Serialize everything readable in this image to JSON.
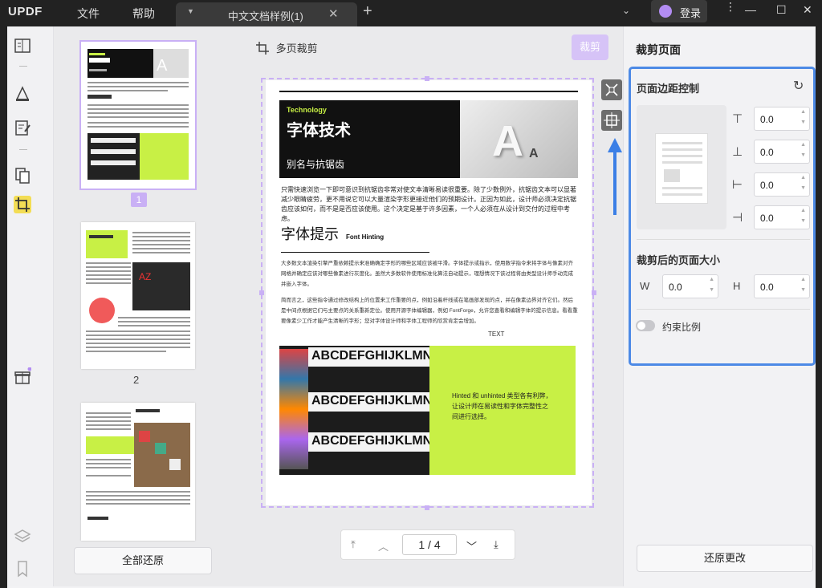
{
  "app": {
    "logo_a": "UPDF",
    "menu_file": "文件",
    "menu_help": "帮助"
  },
  "tab": {
    "title": "中文文档样例(1)"
  },
  "login": {
    "label": "登录"
  },
  "thumbnails": {
    "page1": "1",
    "page2": "2",
    "restore_all": "全部还原"
  },
  "toolbar": {
    "title": "多页裁剪",
    "crop_button": "裁剪"
  },
  "pager": {
    "current": "1",
    "sep": "/",
    "total": "4"
  },
  "document": {
    "tag": "Technology",
    "heading": "字体技术",
    "subheading": "别名与抗锯齿",
    "para1": "只需快速浏览一下即可意识到抗锯齿非常对使文本清晰易读很重要。除了少数例外，抗锯齿文本可以显著减少眼睛疲劳，更不用说它可以大量渲染字形更接近他们的预期设计。正因为如此，设计师必须决定抗锯齿应该如何，而不是是否应该使用。这个决定是基于许多因素，一个人必须在从设计到交付的过程中考虑。",
    "h2": "字体提示",
    "h2_en": "Font Hinting",
    "para2": "大多数文本渲染引擎严重依赖提示来准确确定字形的哪些区域应该被平滑。字体提示或指示，使用数学指令来将字体与像素对齐网格并确定应该对哪些像素进行灰度化。虽然大多数软件使用标准化算法自动提示，理想情况下该过程将由类型设计师手动完成并嵌入字体。",
    "para3": "简而言之，这些指令通过修改结构上的位置来工作重要的点，例如沿着杆线或在笔画部发现的点，并在像素边界对齐它们。然后是中间点根据它们与主要点的关系重新定位。使用开源字体编辑器，例如 FontForge，允许您查看和编辑字体的提示信息。看看重要像素少工作才能产生清晰的字形；您对字体设计师和字体工程师的欣赏肯定会增加。",
    "text_label": "TEXT",
    "abc": "ABCDEFGHIJKLMNO",
    "hinted": "Hinted 和 unhinted 类型各有利弊，让设计师在易读性和字体完整性之间进行选择。"
  },
  "right_panel": {
    "title": "裁剪页面",
    "margin_section": "页面边距控制",
    "top": "0.0",
    "bottom": "0.0",
    "left": "0.0",
    "right": "0.0",
    "size_section": "裁剪后的页面大小",
    "w_label": "W",
    "h_label": "H",
    "w": "0.0",
    "h": "0.0",
    "constrain": "约束比例",
    "restore_changes": "还原更改"
  },
  "colors": {
    "accent": "#b28cf2",
    "highlight_border": "#4d8ae6",
    "lime": "#c8f045"
  }
}
